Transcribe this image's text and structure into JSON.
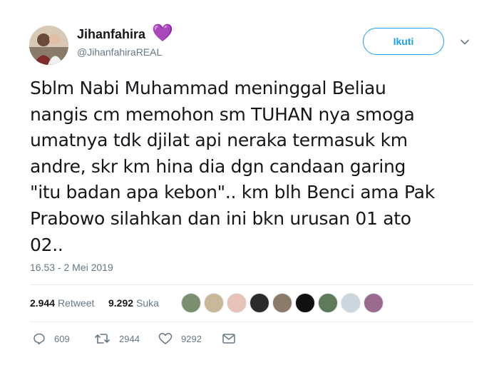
{
  "user": {
    "display_name": "Jihanfahira",
    "handle": "@JihanfahiraREAL",
    "badge_icon": "purple-heart-icon"
  },
  "follow_label": "Ikuti",
  "tweet": {
    "text": "Sblm Nabi Muhammad meninggal Beliau\nnangis cm memohon sm TUHAN nya smoga\numatnya tdk djilat api neraka termasuk km\nandre, skr km hina dia dgn candaan garing\n\"itu badan apa kebon\".. km blh Benci ama Pak\nPrabowo silahkan dan ini bkn urusan 01 ato\n02..",
    "timestamp": "16.53 - 2 Mei 2019"
  },
  "stats": {
    "retweet_count": "2.944",
    "retweet_label": "Retweet",
    "like_count": "9.292",
    "like_label": "Suka"
  },
  "likers": [
    {
      "color": "#7a8f6e"
    },
    {
      "color": "#c9b79a"
    },
    {
      "color": "#e8c4b8"
    },
    {
      "color": "#2b2b2b"
    },
    {
      "color": "#8c7b6a"
    },
    {
      "color": "#111111"
    },
    {
      "color": "#5d7a5a"
    },
    {
      "color": "#ccd6dd"
    },
    {
      "color": "#9a6b8f"
    }
  ],
  "actions": {
    "reply_count": "609",
    "retweet_count": "2944",
    "like_count": "9292"
  },
  "colors": {
    "accent": "#1da1f2",
    "muted": "#657786",
    "text": "#14171a",
    "heart": "#ab8ee8"
  }
}
